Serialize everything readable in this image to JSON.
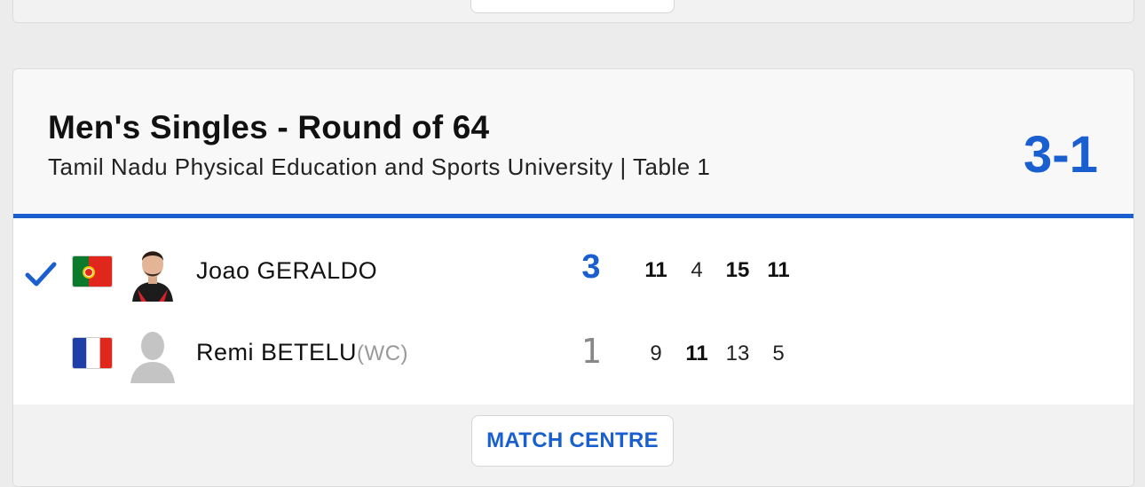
{
  "match": {
    "title": "Men's Singles - Round of 64",
    "venue": "Tamil Nadu Physical Education and Sports University | Table 1",
    "overall_score": "3-1"
  },
  "players": [
    {
      "name": "Joao GERALDO",
      "tag": "",
      "country_flag": "portugal-flag",
      "winner": true,
      "sets_won": "3",
      "games": [
        {
          "score": "11",
          "won": true
        },
        {
          "score": "4",
          "won": false
        },
        {
          "score": "15",
          "won": true
        },
        {
          "score": "11",
          "won": true
        }
      ]
    },
    {
      "name": "Remi BETELU",
      "tag": "(WC)",
      "country_flag": "france-flag",
      "winner": false,
      "sets_won": "1",
      "games": [
        {
          "score": "9",
          "won": false
        },
        {
          "score": "11",
          "won": true
        },
        {
          "score": "13",
          "won": false
        },
        {
          "score": "5",
          "won": false
        }
      ]
    }
  ],
  "footer": {
    "match_centre_label": "MATCH CENTRE"
  },
  "colors": {
    "accent": "#1a5fd0",
    "winner_check": "#1a5fd0"
  },
  "icons": {
    "winner": "check-icon",
    "avatar_placeholder": "user-silhouette-icon"
  }
}
